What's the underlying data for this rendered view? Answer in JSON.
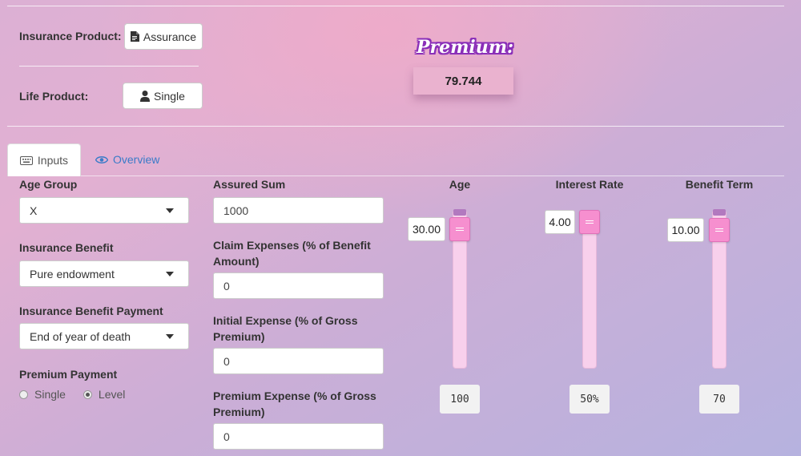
{
  "header": {
    "insurance_product_label": "Insurance Product:",
    "insurance_product_button": "Assurance",
    "life_product_label": "Life Product:",
    "life_product_button": "Single",
    "premium_title": "Premium:",
    "premium_value": "79.744"
  },
  "tabs": [
    {
      "label": "Inputs",
      "icon": "keyboard-icon",
      "active": true
    },
    {
      "label": "Overview",
      "icon": "eye-icon",
      "active": false
    }
  ],
  "form": {
    "age_group": {
      "label": "Age Group",
      "value": "X"
    },
    "insurance_benefit": {
      "label": "Insurance Benefit",
      "value": "Pure endowment"
    },
    "benefit_payment": {
      "label": "Insurance Benefit Payment",
      "value": "End of year of death"
    },
    "premium_payment": {
      "label": "Premium Payment",
      "options": [
        {
          "label": "Single",
          "selected": false
        },
        {
          "label": "Level",
          "selected": true
        }
      ]
    },
    "assured_sum": {
      "label": "Assured Sum",
      "value": "1000"
    },
    "claim_expenses": {
      "label": "Claim Expenses (% of Benefit Amount)",
      "line1": "Claim Expenses (% of Benefit",
      "line2": "Amount)",
      "value": "0"
    },
    "initial_expense": {
      "label": "Initial Expense (% of Gross Premium)",
      "line1": "Initial Expense (% of Gross",
      "line2": "Premium)",
      "value": "0"
    },
    "premium_expense": {
      "label": "Premium Expense (% of Gross Premium)",
      "line1": "Premium Expense (% of Gross",
      "line2": "Premium)",
      "value": "0"
    }
  },
  "sliders": [
    {
      "label": "Age",
      "value": "30.00",
      "max": "100"
    },
    {
      "label": "Interest Rate",
      "value": "4.00",
      "max": "50%"
    },
    {
      "label": "Benefit Term",
      "value": "10.00",
      "max": "70"
    }
  ],
  "colors": {
    "accent_slider": "#f68fcf",
    "track": "#f8d0ec",
    "premium_box": "#eab2cf",
    "premium_title_outline": "#8a2fb8",
    "link": "#3a7bc8"
  }
}
